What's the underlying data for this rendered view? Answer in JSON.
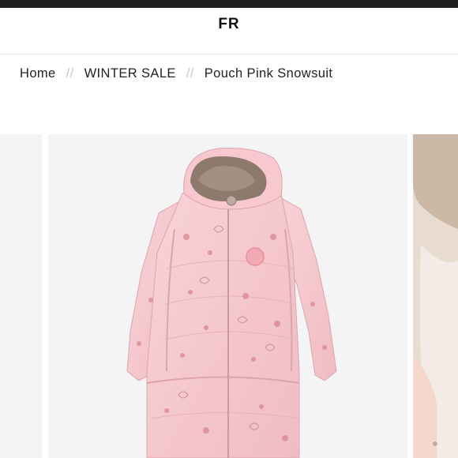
{
  "header": {
    "language_toggle": "FR"
  },
  "breadcrumb": {
    "items": [
      "Home",
      "WINTER SALE",
      "Pouch Pink Snowsuit"
    ],
    "separator": "//"
  },
  "gallery": {
    "main_image": {
      "subject": "pink baby snowsuit pouch with fur-lined hood",
      "icon": "product-photo"
    },
    "colors": {
      "suit": "#f6c9cf",
      "fur": "#8e7a6d",
      "background": "#f4f4f4"
    }
  }
}
